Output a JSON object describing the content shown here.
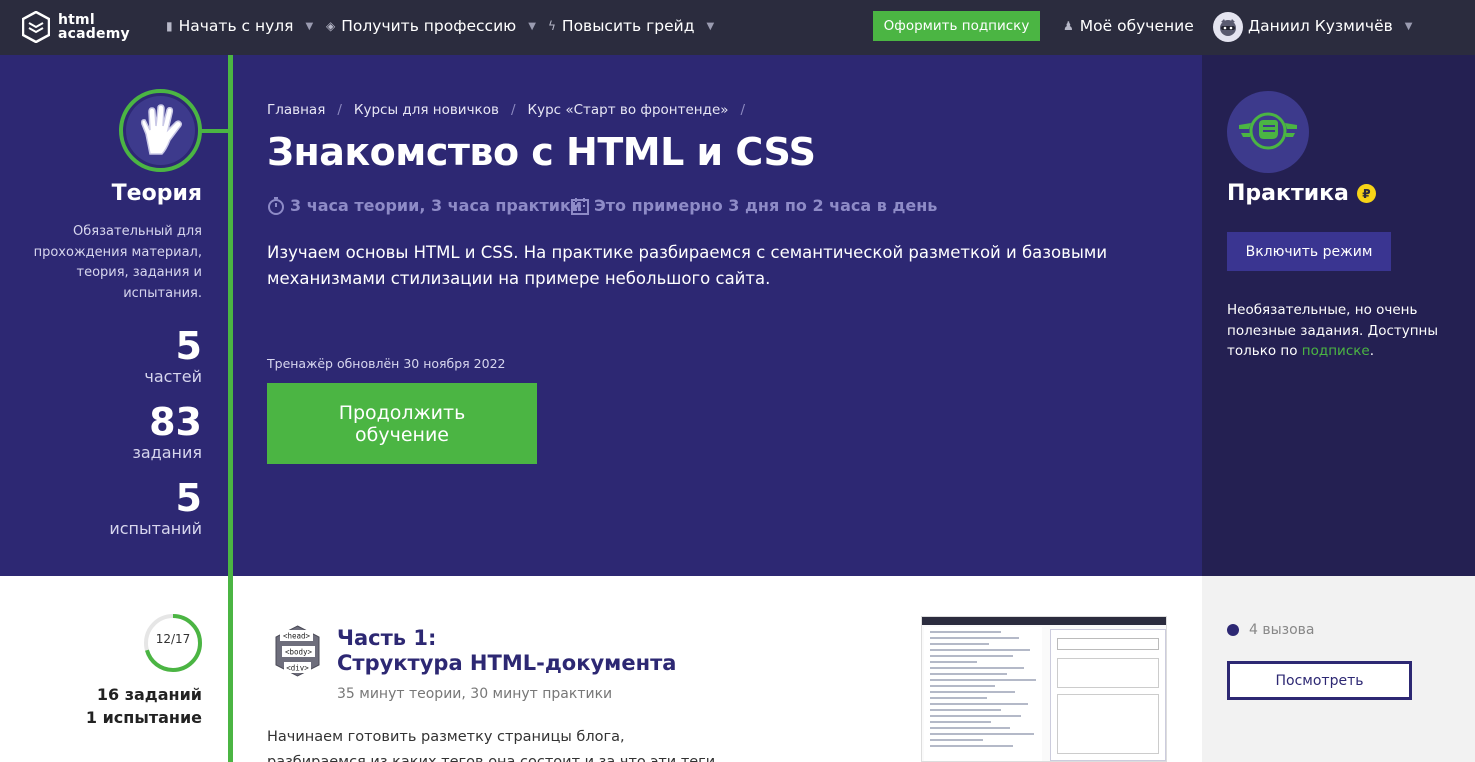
{
  "header": {
    "logo_text": "html\nacademy",
    "nav": [
      {
        "label": "Начать с нуля",
        "icon": "bar-chart-icon"
      },
      {
        "label": "Получить профессию",
        "icon": "graduation-cap-icon"
      },
      {
        "label": "Повысить грейд",
        "icon": "lightning-icon"
      }
    ],
    "subscribe_label": "Оформить подписку",
    "my_learning_label": "Моё обучение",
    "user_name": "Даниил Кузмичёв"
  },
  "theory": {
    "title": "Теория",
    "description": "Обязательный для прохождения материал, теория, задания и испытания.",
    "stats": [
      {
        "value": "5",
        "label": "частей"
      },
      {
        "value": "83",
        "label": "задания"
      },
      {
        "value": "5",
        "label": "испытаний"
      }
    ]
  },
  "course": {
    "breadcrumbs": [
      "Главная",
      "Курсы для новичков",
      "Курс «Старт во фронтенде»"
    ],
    "title": "Знакомство с HTML и CSS",
    "duration": "3 часа теории, 3 часа практики",
    "schedule": "Это примерно 3 дня по 2 часа в день",
    "intro": "Изучаем основы HTML и CSS. На практике разбираемся с семантической разметкой и базовыми механизмами стилизации на примере небольшого сайта.",
    "updated": "Тренажёр обновлён 30 ноября 2022",
    "continue_label": "Продолжить обучение"
  },
  "practice": {
    "title": "Практика",
    "coin_symbol": "₽",
    "mode_button": "Включить режим",
    "description_prefix": "Необязательные, но очень полезные задания. Доступны только по ",
    "description_link": "подписке",
    "description_suffix": "."
  },
  "part": {
    "progress_text": "12/17",
    "progress_fraction": 0.7059,
    "tasks": "16 заданий",
    "trials": "1 испытание",
    "icon_tags": [
      "<head>",
      "<body>",
      "<div>"
    ],
    "title_line1": "Часть 1:",
    "title_line2": "Структура HTML-документа",
    "meta": "35 минут теории, 30 минут практики",
    "description": "Начинаем готовить разметку страницы блога, разбираемся из каких тегов она состоит и за что эти теги отвечают.",
    "challenges": "4 вызова",
    "view_button": "Посмотреть"
  },
  "colors": {
    "accent_green": "#4bb543",
    "hero_bg": "#2d2873",
    "practice_bg": "#242052",
    "topbar_bg": "#2b2c3e",
    "coin": "#f7d417"
  }
}
